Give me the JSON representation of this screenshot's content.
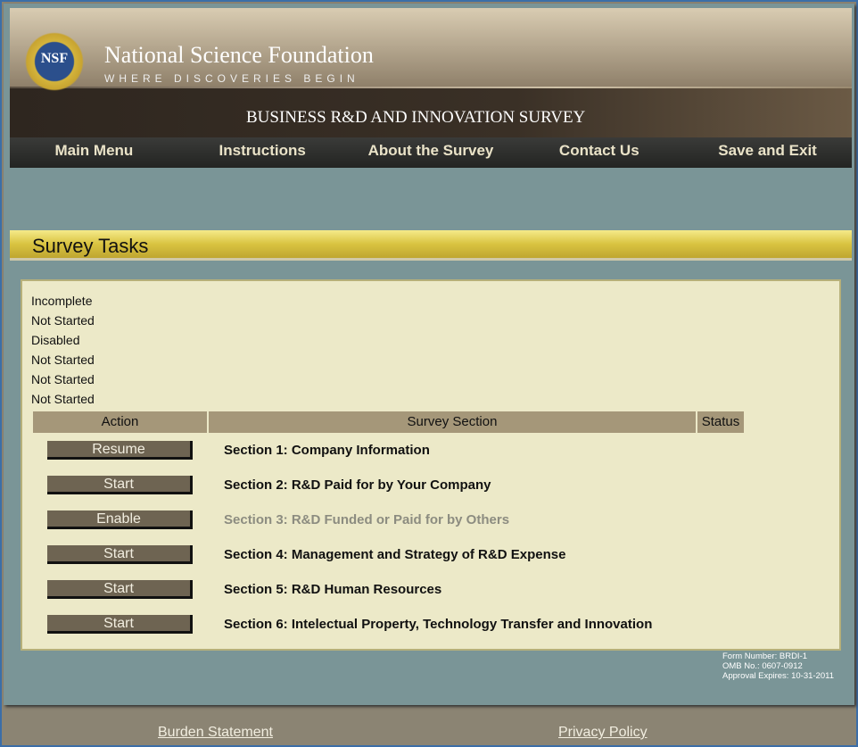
{
  "header": {
    "org": "National Science Foundation",
    "tagline": "WHERE DISCOVERIES BEGIN",
    "logo_text": "NSF",
    "survey_title": "BUSINESS R&D AND INNOVATION SURVEY"
  },
  "nav": [
    "Main Menu",
    "Instructions",
    "About the Survey",
    "Contact Us",
    "Save and Exit"
  ],
  "page_title": "Survey Tasks",
  "statuses": [
    "Incomplete",
    "Not Started",
    "Disabled",
    "Not Started",
    "Not Started",
    "Not Started"
  ],
  "table": {
    "headers": [
      "Action",
      "Survey Section",
      "Status"
    ],
    "rows": [
      {
        "action": "Resume",
        "section": "Section 1: Company Information",
        "disabled": false
      },
      {
        "action": "Start",
        "section": "Section 2: R&D Paid for by Your Company",
        "disabled": false
      },
      {
        "action": "Enable",
        "section": "Section 3: R&D Funded or Paid for by Others",
        "disabled": true
      },
      {
        "action": "Start",
        "section": "Section 4: Management and Strategy of R&D Expense",
        "disabled": false
      },
      {
        "action": "Start",
        "section": "Section 5: R&D Human Resources",
        "disabled": false
      },
      {
        "action": "Start",
        "section": "Section 6: Intelectual Property, Technology Transfer and Innovation",
        "disabled": false
      }
    ]
  },
  "form_info": [
    "Form Number: BRDI-1",
    "OMB No.: 0607-0912",
    "Approval Expires: 10-31-2011"
  ],
  "footer": {
    "burden": "Burden Statement",
    "privacy": "Privacy Policy"
  }
}
